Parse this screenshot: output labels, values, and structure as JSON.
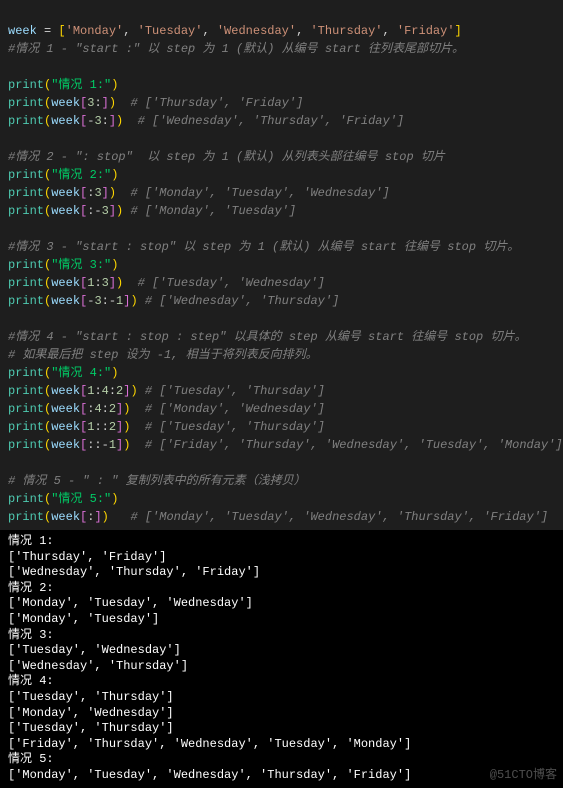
{
  "code": {
    "line1_var": "week",
    "line1_eq": " = ",
    "line1_lb": "[",
    "line1_items": [
      "'Monday'",
      "'Tuesday'",
      "'Wednesday'",
      "'Thursday'",
      "'Friday'"
    ],
    "line1_rb": "]",
    "sec1_comment": "#情况 1 - \"start :\" 以 step 为 1 (默认) 从编号 start 往列表尾部切片。",
    "sec1_print_label": "print(\"情况 1:\")",
    "sec1_l1_code": "print(week[3:])",
    "sec1_l1_cmt": "  # ['Thursday', 'Friday']",
    "sec1_l2_code": "print(week[-3:])",
    "sec1_l2_cmt": "  # ['Wednesday', 'Thursday', 'Friday']",
    "sec2_comment": "#情况 2 - \": stop\"  以 step 为 1 (默认) 从列表头部往编号 stop 切片",
    "sec2_print_label": "print(\"情况 2:\")",
    "sec2_l1_code": "print(week[:3])",
    "sec2_l1_cmt": "  # ['Monday', 'Tuesday', 'Wednesday']",
    "sec2_l2_code": "print(week[:-3])",
    "sec2_l2_cmt": " # ['Monday', 'Tuesday']",
    "sec3_comment": "#情况 3 - \"start : stop\" 以 step 为 1 (默认) 从编号 start 往编号 stop 切片。",
    "sec3_print_label": "print(\"情况 3:\")",
    "sec3_l1_code": "print(week[1:3])",
    "sec3_l1_cmt": "  # ['Tuesday', 'Wednesday']",
    "sec3_l2_code": "print(week[-3:-1])",
    "sec3_l2_cmt": " # ['Wednesday', 'Thursday']",
    "sec4_comment1": "#情况 4 - \"start : stop : step\" 以具体的 step 从编号 start 往编号 stop 切片。",
    "sec4_comment2": "# 如果最后把 step 设为 -1, 相当于将列表反向排列。",
    "sec4_print_label": "print(\"情况 4:\")",
    "sec4_l1_code": "print(week[1:4:2])",
    "sec4_l1_cmt": " # ['Tuesday', 'Thursday']",
    "sec4_l2_code": "print(week[:4:2])",
    "sec4_l2_cmt": "  # ['Monday', 'Wednesday']",
    "sec4_l3_code": "print(week[1::2])",
    "sec4_l3_cmt": "  # ['Tuesday', 'Thursday']",
    "sec4_l4_code": "print(week[::-1])",
    "sec4_l4_cmt": "  # ['Friday', 'Thursday', 'Wednesday', 'Tuesday', 'Monday']",
    "sec5_comment": "# 情况 5 - \" : \" 复制列表中的所有元素（浅拷贝）",
    "sec5_print_label": "print(\"情况 5:\")",
    "sec5_l1_code": "print(week[:])",
    "sec5_l1_cmt": "   # ['Monday', 'Tuesday', 'Wednesday', 'Thursday', 'Friday']"
  },
  "output": {
    "lines": [
      "情况 1:",
      "['Thursday', 'Friday']",
      "['Wednesday', 'Thursday', 'Friday']",
      "情况 2:",
      "['Monday', 'Tuesday', 'Wednesday']",
      "['Monday', 'Tuesday']",
      "情况 3:",
      "['Tuesday', 'Wednesday']",
      "['Wednesday', 'Thursday']",
      "情况 4:",
      "['Tuesday', 'Thursday']",
      "['Monday', 'Wednesday']",
      "['Tuesday', 'Thursday']",
      "['Friday', 'Thursday', 'Wednesday', 'Tuesday', 'Monday']",
      "情况 5:",
      "['Monday', 'Tuesday', 'Wednesday', 'Thursday', 'Friday']"
    ]
  },
  "watermark": "@51CTO博客"
}
